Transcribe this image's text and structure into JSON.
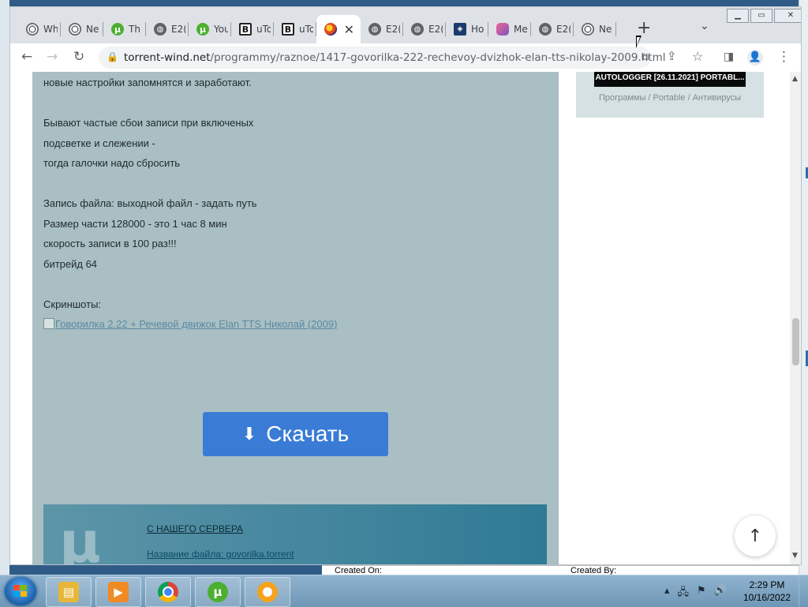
{
  "browser": {
    "tabs": [
      {
        "icon": "chrome-icon",
        "title": "Wh"
      },
      {
        "icon": "chrome-icon",
        "title": "Ne"
      },
      {
        "icon": "utorrent-icon",
        "title": "Th"
      },
      {
        "icon": "globe-icon",
        "title": "E2("
      },
      {
        "icon": "utorrent-icon",
        "title": "You"
      },
      {
        "icon": "bold-b-icon",
        "title": "uTo"
      },
      {
        "icon": "bold-b-icon",
        "title": "uTo"
      },
      {
        "icon": "firefox-icon",
        "title": "",
        "active": true
      },
      {
        "icon": "globe-icon",
        "title": "E2("
      },
      {
        "icon": "globe-icon",
        "title": "E2("
      },
      {
        "icon": "hc-icon",
        "title": "Ho"
      },
      {
        "icon": "me-icon",
        "title": "Me"
      },
      {
        "icon": "globe-icon",
        "title": "E2("
      },
      {
        "icon": "chrome-icon",
        "title": "Ne"
      }
    ],
    "new_tab": "+",
    "tab_search": "⌄",
    "url_host": "torrent-wind.net",
    "url_path": "/programmy/raznoe/1417-govorilka-222-rechevoy-dvizhok-elan-tts-nikolay-2009.html"
  },
  "article": {
    "line_settings": "новые настройки запомнятся и заработают.",
    "line_fail1": "Бывают частые сбои записи при включеных",
    "line_fail2": "подсветке и слежении -",
    "line_fail3": "тогда галочки надо сбросить",
    "line_rec1": "Запись файла: выходной файл - задать путь",
    "line_rec2": "Размер части 128000 - это 1 час 8 мин",
    "line_rec3": "скорость записи в 100 раз!!!",
    "line_rec4": "битрейд 64",
    "screenshots_label": "Скриншоты:",
    "screenshot_alt": "Говорилка 2.22 + Речевой движок Elan TTS Николай (2009)",
    "download_label": "Скачать",
    "server_title": "С НАШЕГО СЕРВЕРА",
    "file_name": "Название файла: govorilka.torrent"
  },
  "sidebar": {
    "card_title": "AUTOLOGGER [26.11.2021] PORTABL...",
    "card_categories": "Программы / Portable / Антивирусы"
  },
  "behind_window": {
    "created_on": "Created On:",
    "created_by": "Created By:"
  },
  "taskbar": {
    "time": "2:29 PM",
    "date": "10/16/2022"
  }
}
